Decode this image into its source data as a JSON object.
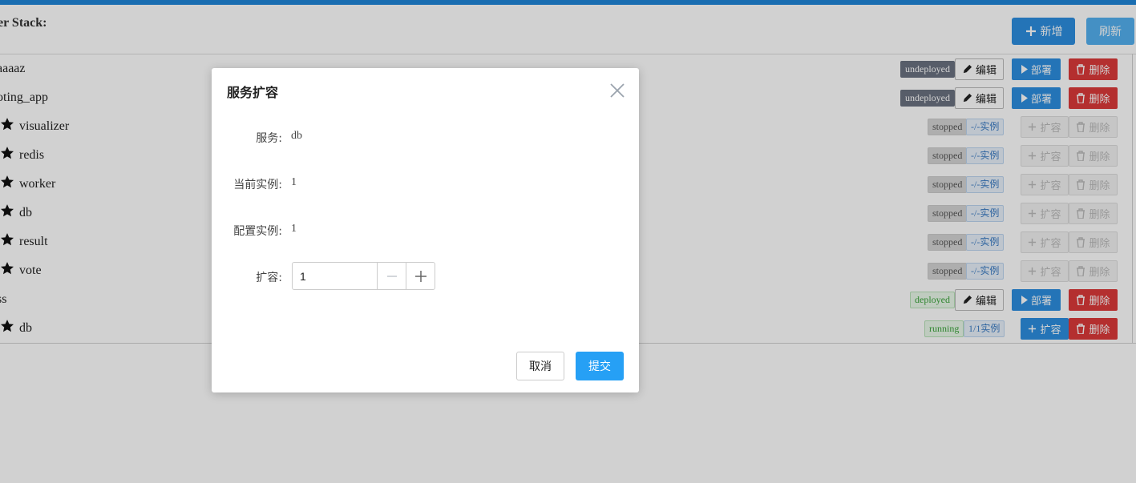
{
  "stack": {
    "title": "er Stack:"
  },
  "toolbar": {
    "add_label": "新增",
    "refresh_label": "刷新"
  },
  "rows": [
    {
      "name": "aaaaz",
      "status": "undeployed",
      "edit": "编辑",
      "deploy": "部署",
      "delete": "删除"
    },
    {
      "name": "oting_app",
      "status": "undeployed",
      "edit": "编辑",
      "deploy": "部署",
      "delete": "删除"
    },
    {
      "name": "visualizer",
      "status": "stopped",
      "instances": "-/-实例",
      "scale": "扩容",
      "delete": "删除"
    },
    {
      "name": "redis",
      "status": "stopped",
      "instances": "-/-实例",
      "scale": "扩容",
      "delete": "删除"
    },
    {
      "name": "worker",
      "status": "stopped",
      "instances": "-/-实例",
      "scale": "扩容",
      "delete": "删除"
    },
    {
      "name": "db",
      "status": "stopped",
      "instances": "-/-实例",
      "scale": "扩容",
      "delete": "删除"
    },
    {
      "name": "result",
      "status": "stopped",
      "instances": "-/-实例",
      "scale": "扩容",
      "delete": "删除"
    },
    {
      "name": "vote",
      "status": "stopped",
      "instances": "-/-实例",
      "scale": "扩容",
      "delete": "删除"
    },
    {
      "name": "ss",
      "status": "deployed",
      "edit": "编辑",
      "deploy": "部署",
      "delete": "删除"
    },
    {
      "name": "db",
      "status": "running",
      "instances": "1/1实例",
      "scale": "扩容",
      "delete": "删除"
    }
  ],
  "modal": {
    "title": "服务扩容",
    "service_label": "服务:",
    "service_value": "db",
    "current_label": "当前实例:",
    "current_value": "1",
    "config_label": "配置实例:",
    "config_value": "1",
    "scale_label": "扩容:",
    "scale_value": "1",
    "cancel_label": "取消",
    "submit_label": "提交"
  },
  "colors": {
    "primary": "#2d8ee0",
    "danger": "#dc3a3a",
    "submit": "#26a0f5",
    "topbar": "#1f86d8"
  }
}
